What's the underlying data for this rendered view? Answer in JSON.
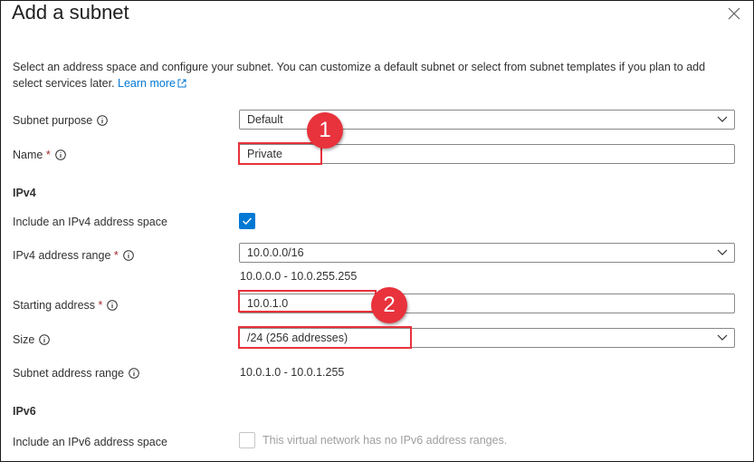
{
  "panel": {
    "title": "Add a subnet",
    "description": "Select an address space and configure your subnet. You can customize a default subnet or select from subnet templates if you plan to add select services later.",
    "learn_more": "Learn more"
  },
  "form": {
    "subnet_purpose": {
      "label": "Subnet purpose",
      "value": "Default"
    },
    "name": {
      "label": "Name",
      "required_mark": "*",
      "value": "Private"
    },
    "ipv4_section": "IPv4",
    "include_ipv4": {
      "label": "Include an IPv4 address space",
      "checked": true
    },
    "ipv4_range": {
      "label": "IPv4 address range",
      "required_mark": "*",
      "value": "10.0.0.0/16",
      "range_text": "10.0.0.0 - 10.0.255.255"
    },
    "starting_address": {
      "label": "Starting address",
      "required_mark": "*",
      "value": "10.0.1.0"
    },
    "size": {
      "label": "Size",
      "value": "/24 (256 addresses)"
    },
    "subnet_range": {
      "label": "Subnet address range",
      "value": "10.0.1.0 - 10.0.1.255"
    },
    "ipv6_section": "IPv6",
    "include_ipv6": {
      "label": "Include an IPv6 address space",
      "checked": false,
      "disabled_text": "This virtual network has no IPv6 address ranges."
    }
  },
  "annotations": [
    {
      "number": "1"
    },
    {
      "number": "2"
    }
  ],
  "colors": {
    "accent": "#0078d4",
    "annotation": "#e8323c",
    "required": "#a4262c"
  }
}
